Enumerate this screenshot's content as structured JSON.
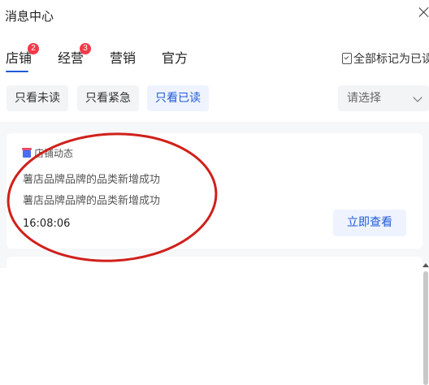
{
  "header": {
    "title": "消息中心"
  },
  "tabs": [
    {
      "label": "店铺",
      "badge": "2",
      "active": true
    },
    {
      "label": "经营",
      "badge": "3",
      "active": false
    },
    {
      "label": "营销",
      "badge": null,
      "active": false
    },
    {
      "label": "官方",
      "badge": null,
      "active": false
    }
  ],
  "actions": {
    "mark_all_read": "全部标记为已读"
  },
  "filters": [
    {
      "label": "只看未读",
      "active": false
    },
    {
      "label": "只看紧急",
      "active": false
    },
    {
      "label": "只看已读",
      "active": true
    }
  ],
  "select": {
    "placeholder": "请选择"
  },
  "messages": [
    {
      "category": "店铺动态",
      "lines": [
        "薯店品牌品牌的品类新增成功",
        "薯店品牌品牌的品类新增成功"
      ],
      "time": "16:08:06",
      "action_label": "立即查看"
    }
  ],
  "colors": {
    "accent": "#1f5bd8",
    "badge": "#f5384a",
    "annotation": "#d0201b"
  }
}
